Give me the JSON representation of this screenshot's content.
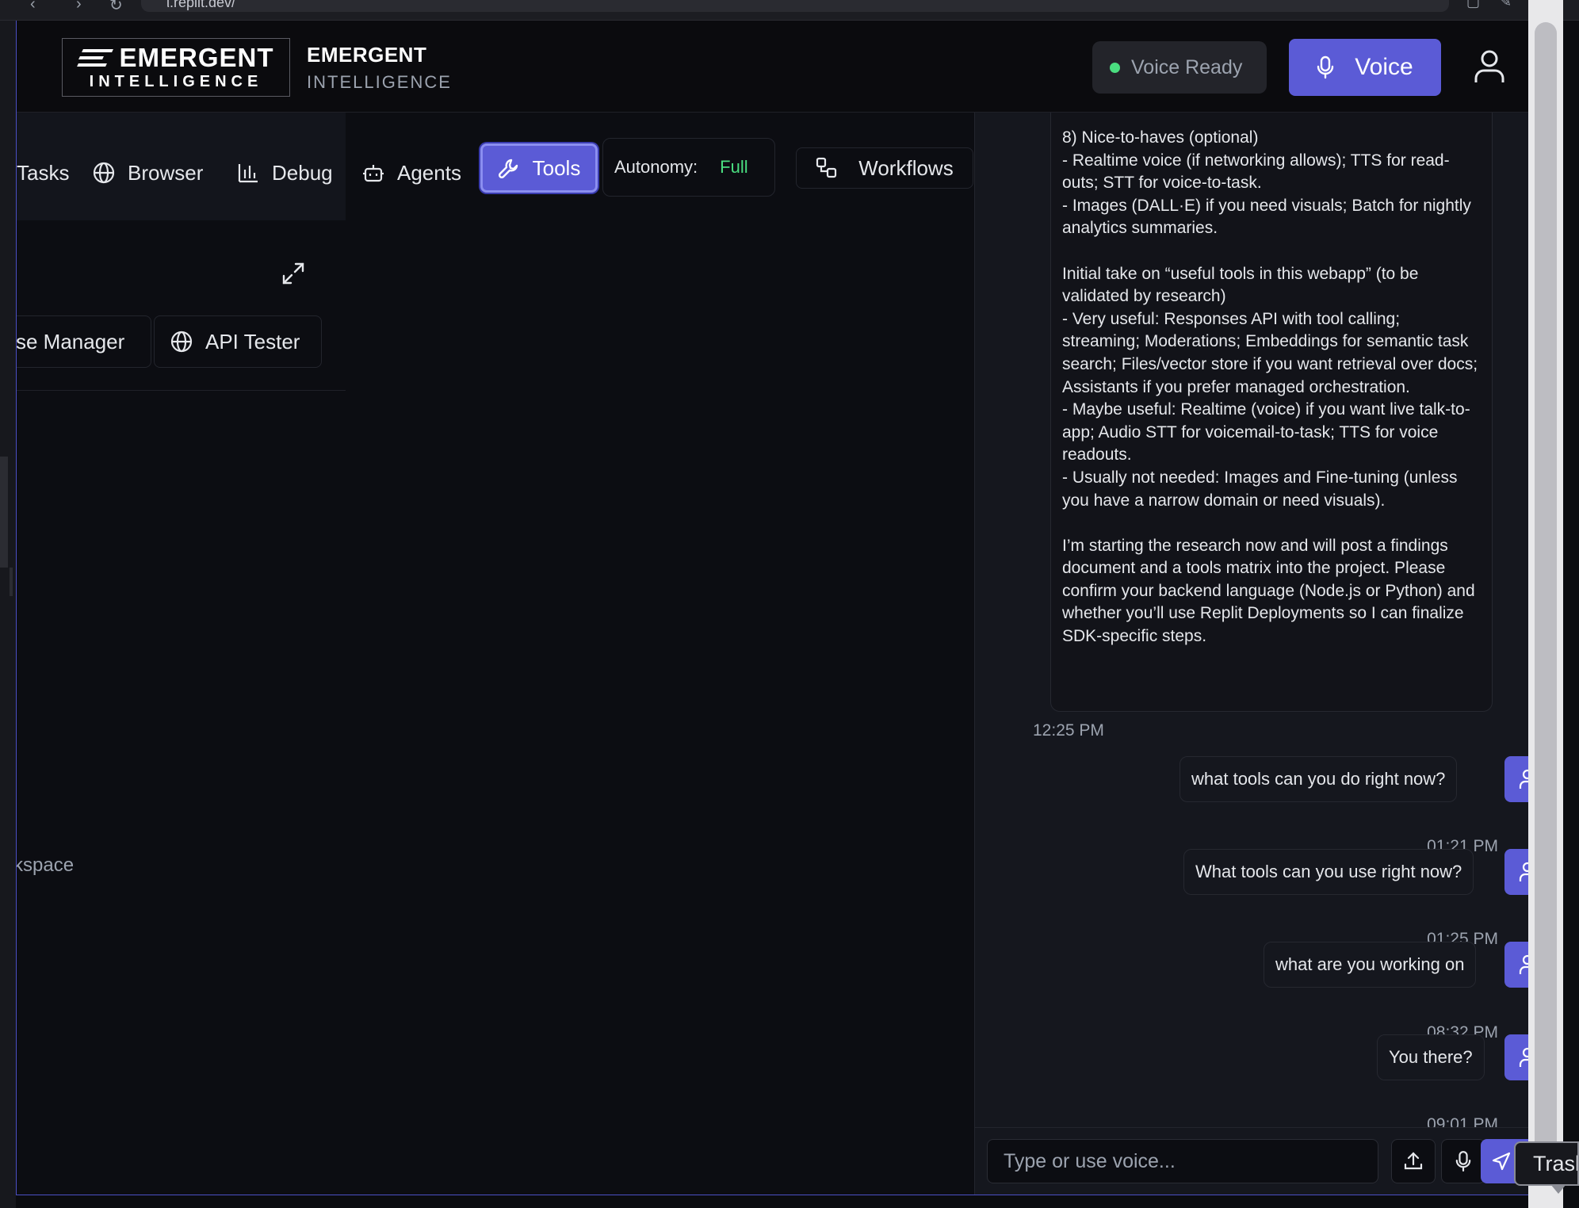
{
  "browser": {
    "url": "ι.replit.dev/"
  },
  "header": {
    "logo": {
      "top": "EMERGENT",
      "sub": "INTELLIGENCE"
    },
    "brand_title": "EMERGENT",
    "brand_subtitle": "INTELLIGENCE",
    "voice_status": "Voice Ready",
    "voice_button": "Voice",
    "colors": {
      "accent": "#5b5bd6",
      "status_ok": "#4ade80"
    }
  },
  "tabs": {
    "tasks": "Tasks",
    "browser": "Browser",
    "debug": "Debug",
    "agents": "Agents",
    "tools": "Tools",
    "autonomy_label": "Autonomy:",
    "autonomy_value": "Full",
    "workflows": "Workflows",
    "active": "Tools"
  },
  "tools_panel": {
    "license_manager": "se Manager",
    "api_tester": "API Tester",
    "workspace_hint": "kspace"
  },
  "chat": {
    "assistant_message": "8) Nice-to-haves (optional)\n- Realtime voice (if networking allows); TTS for read-outs; STT for voice-to-task.\n- Images (DALL·E) if you need visuals; Batch for nightly analytics summaries.\n\nInitial take on “useful tools in this webapp” (to be validated by research)\n- Very useful: Responses API with tool calling; streaming; Moderations; Embeddings for semantic task search; Files/vector store if you want retrieval over docs; Assistants if you prefer managed orchestration.\n- Maybe useful: Realtime (voice) if you want live talk-to-app; Audio STT for voicemail-to-task; TTS for voice readouts.\n- Usually not needed: Images and Fine-tuning (unless you have a narrow domain or need visuals).\n\nI’m starting the research now and will post a findings document and a tools matrix into the project. Please confirm your backend language (Node.js or Python) and whether you’ll use Replit Deployments so I can finalize SDK-specific steps.",
    "assistant_time": "12:25 PM",
    "user_messages": [
      {
        "text": "what tools can you do right now?",
        "time": "01:21 PM"
      },
      {
        "text": "What tools can you use right now?",
        "time": "01:25 PM"
      },
      {
        "text": "what are you working on",
        "time": "08:32 PM"
      },
      {
        "text": "You there?",
        "time": "09:01 PM"
      }
    ],
    "input_placeholder": "Type or use voice...",
    "tooltip": "Trash"
  },
  "icons": {
    "browser": "globe-icon",
    "debug": "bar-chart-icon",
    "agents": "bot-icon",
    "tools": "wrench-icon",
    "workflows": "workflow-icon",
    "api_tester": "globe-icon",
    "expand": "expand-icon",
    "voice": "mic-icon",
    "user": "user-icon",
    "upload": "upload-icon",
    "mic": "mic-icon",
    "send": "send-icon"
  }
}
